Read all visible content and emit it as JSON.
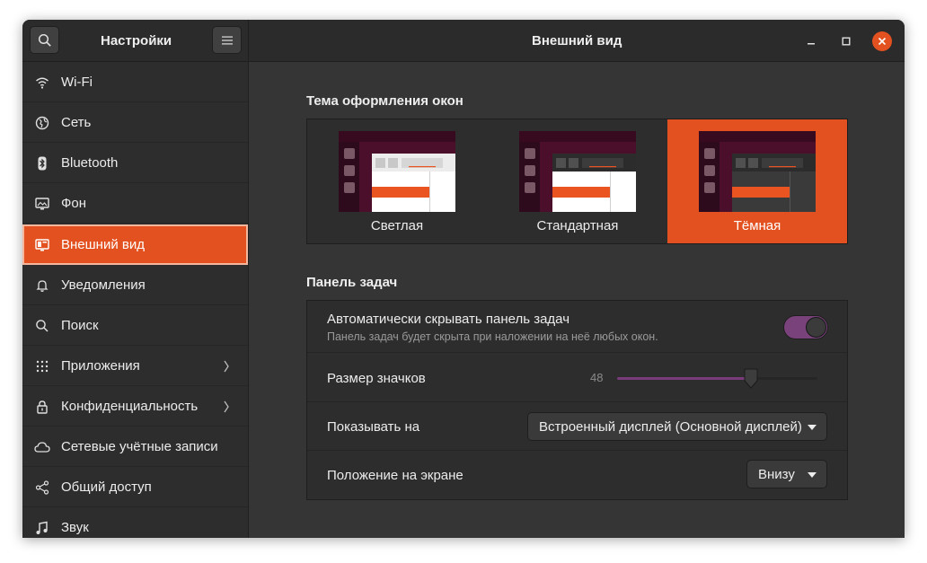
{
  "header": {
    "left_title": "Настройки",
    "title": "Внешний вид",
    "search_icon": "search-icon",
    "menu_icon": "hamburger-menu-icon",
    "window_controls": [
      "minimize-icon",
      "maximize-icon",
      "close-icon"
    ],
    "close_color": "#e2511f"
  },
  "sidebar": {
    "items": [
      {
        "label": "Wi-Fi",
        "icon": "wifi-icon"
      },
      {
        "label": "Сеть",
        "icon": "network-globe-icon"
      },
      {
        "label": "Bluetooth",
        "icon": "bluetooth-icon"
      },
      {
        "label": "Фон",
        "icon": "background-icon"
      },
      {
        "label": "Внешний вид",
        "icon": "appearance-icon",
        "active": true
      },
      {
        "label": "Уведомления",
        "icon": "bell-icon"
      },
      {
        "label": "Поиск",
        "icon": "search-icon"
      },
      {
        "label": "Приложения",
        "icon": "apps-grid-icon",
        "chevron": true
      },
      {
        "label": "Конфиденциальность",
        "icon": "lock-icon",
        "chevron": true
      },
      {
        "label": "Сетевые учётные записи",
        "icon": "cloud-icon"
      },
      {
        "label": "Общий доступ",
        "icon": "share-icon"
      },
      {
        "label": "Звук",
        "icon": "music-note-icon"
      }
    ]
  },
  "appearance": {
    "theme_section_title": "Тема оформления окон",
    "themes": [
      {
        "label": "Светлая",
        "selected": false
      },
      {
        "label": "Стандартная",
        "selected": false
      },
      {
        "label": "Тёмная",
        "selected": true
      }
    ],
    "dock_section_title": "Панель задач",
    "autohide": {
      "label": "Автоматически скрывать панель задач",
      "sublabel": "Панель задач будет скрыта при наложении на неё любых окон.",
      "enabled": true
    },
    "icon_size": {
      "label": "Размер значков",
      "value": "48",
      "fraction": 0.67
    },
    "show_on": {
      "label": "Показывать на",
      "value": "Встроенный дисплей (Основной дисплей)"
    },
    "position": {
      "label": "Положение на экране",
      "value": "Внизу"
    }
  },
  "colors": {
    "accent": "#e2511f",
    "switch_on": "#79427a",
    "slider_fill": "#7a3b7a"
  }
}
